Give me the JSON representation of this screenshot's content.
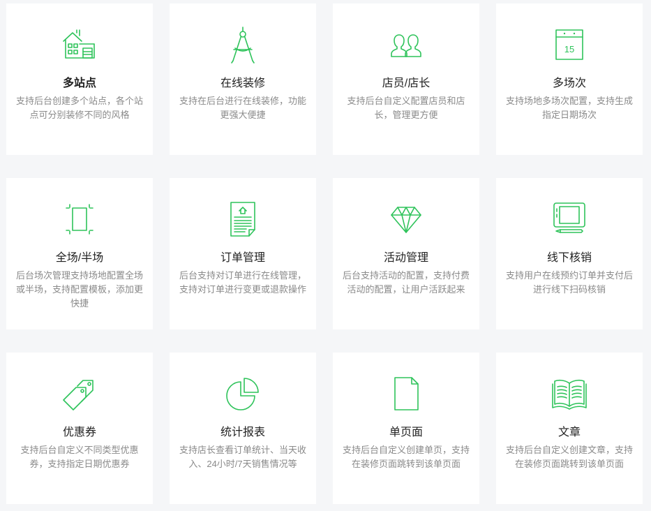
{
  "features": [
    {
      "title": "多站点",
      "desc": "支持后台创建多个站点，各个站点可分别装修不同的风格",
      "icon": "house-icon",
      "bold": true
    },
    {
      "title": "在线装修",
      "desc": "支持在后台进行在线装修，功能更强大便捷",
      "icon": "compass-icon"
    },
    {
      "title": "店员/店长",
      "desc": "支持后台自定义配置店员和店长，管理更方便",
      "icon": "users-icon"
    },
    {
      "title": "多场次",
      "desc": "支持场地多场次配置，支持生成指定日期场次",
      "icon": "calendar-icon",
      "calendar_day": "15"
    },
    {
      "title": "全场/半场",
      "desc": "后台场次管理支持场地配置全场或半场，支持配置模板，添加更快捷",
      "icon": "court-icon"
    },
    {
      "title": "订单管理",
      "desc": "后台支持对订单进行在线管理，支持对订单进行变更或退款操作",
      "icon": "document-icon"
    },
    {
      "title": "活动管理",
      "desc": "后台支持活动的配置，支持付费活动的配置，让用户活跃起来",
      "icon": "diamond-icon"
    },
    {
      "title": "线下核销",
      "desc": "支持用户在线预约订单并支付后进行线下扫码核销",
      "icon": "tablet-icon"
    },
    {
      "title": "优惠券",
      "desc": "支持后台自定义不同类型优惠券，支持指定日期优惠券",
      "icon": "tag-icon"
    },
    {
      "title": "统计报表",
      "desc": "支持店长查看订单统计、当天收入、24小时/7天销售情况等",
      "icon": "pie-chart-icon"
    },
    {
      "title": "单页面",
      "desc": "支持后台自定义创建单页，支持在装修页面跳转到该单页面",
      "icon": "page-icon"
    },
    {
      "title": "文章",
      "desc": "支持后台自定义创建文章，支持在装修页面跳转到该单页面",
      "icon": "book-icon"
    }
  ],
  "accent_color": "#2ec35a"
}
